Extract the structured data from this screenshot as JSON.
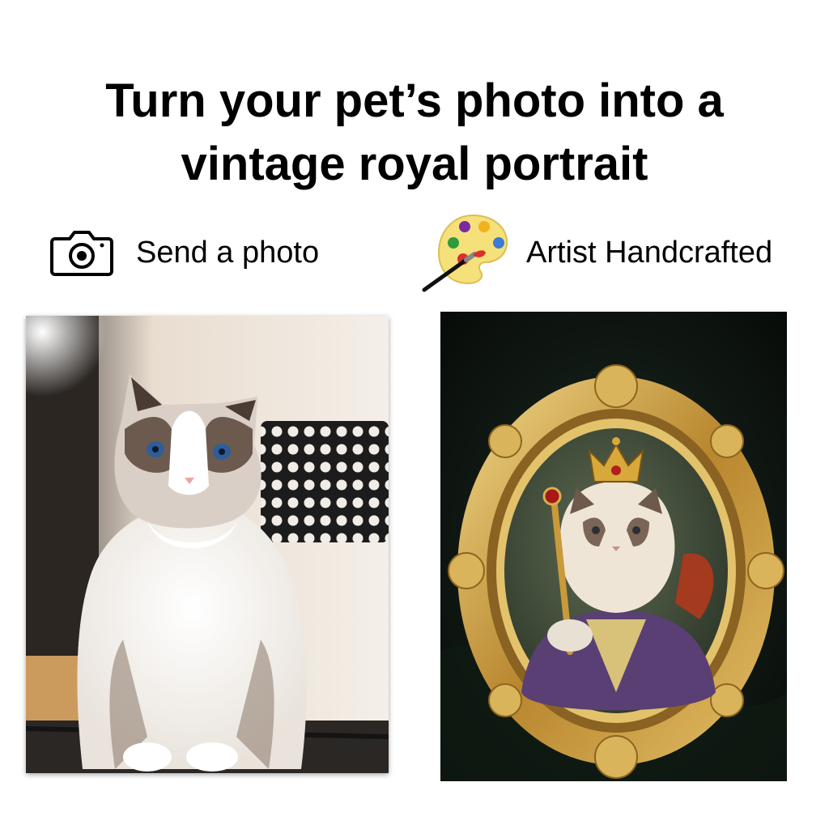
{
  "headline": {
    "line1": "Turn your pet’s photo into a",
    "line2": "vintage royal portrait"
  },
  "features": [
    {
      "icon": "camera-icon",
      "label": "Send a photo"
    },
    {
      "icon": "paint-palette-icon",
      "label": "Artist Handcrafted"
    }
  ],
  "images": {
    "before": "photo of ragdoll cat",
    "after": "royal cat portrait in gold frame"
  },
  "colors": {
    "text": "#000000",
    "frame_gold": "#c9a44a",
    "portrait_background": "#0d120f"
  }
}
